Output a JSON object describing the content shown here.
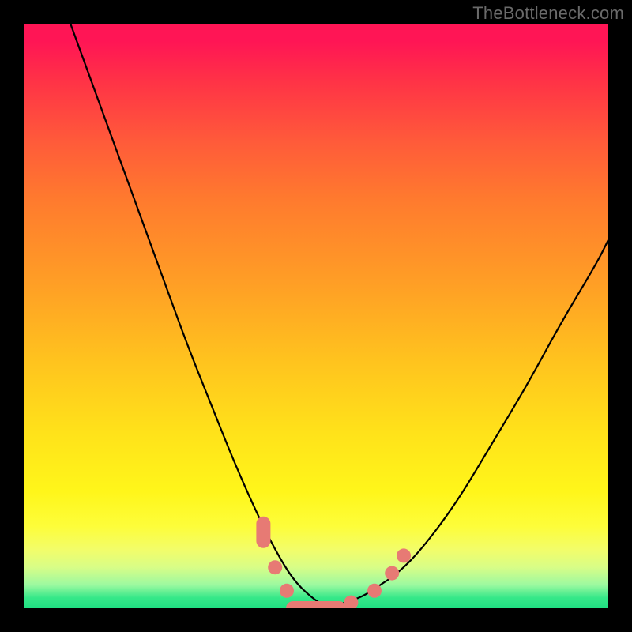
{
  "watermark": "TheBottleneck.com",
  "colors": {
    "background": "#000000",
    "curve": "#000000",
    "marker": "#e77a74",
    "gradient_top": "#ff1555",
    "gradient_bottom": "#1fdf82"
  },
  "chart_data": {
    "type": "line",
    "title": "",
    "xlabel": "",
    "ylabel": "",
    "xlim": [
      0,
      100
    ],
    "ylim": [
      0,
      100
    ],
    "grid": false,
    "legend": false,
    "note": "Bottleneck-style V-curve. x is an unlabeled normalized axis (0–100 left→right); y is bottleneck percentage where 0 = no bottleneck (bottom, green) and 100 = full bottleneck (top, red). Values estimated from pixel positions since axes are unlabeled.",
    "series": [
      {
        "name": "left-branch",
        "x": [
          8,
          12,
          16,
          20,
          24,
          28,
          32,
          36,
          40,
          43,
          46,
          49,
          52
        ],
        "y": [
          100,
          89,
          78,
          67,
          56,
          45,
          35,
          25,
          16,
          10,
          5,
          2,
          0
        ]
      },
      {
        "name": "right-branch",
        "x": [
          52,
          55,
          58,
          61,
          64,
          68,
          74,
          80,
          86,
          92,
          98,
          100
        ],
        "y": [
          0,
          1,
          2,
          4,
          6,
          10,
          18,
          28,
          38,
          49,
          59,
          63
        ]
      }
    ],
    "markers": {
      "description": "Salmon-colored rounded markers near the curve minimum along the bottom green band.",
      "points": [
        {
          "x": 41,
          "y": 13,
          "shape": "pill-vertical"
        },
        {
          "x": 43,
          "y": 7,
          "shape": "dot"
        },
        {
          "x": 45,
          "y": 3,
          "shape": "dot"
        },
        {
          "x": 50,
          "y": 0,
          "shape": "pill-horizontal"
        },
        {
          "x": 56,
          "y": 1,
          "shape": "dot"
        },
        {
          "x": 60,
          "y": 3,
          "shape": "dot"
        },
        {
          "x": 63,
          "y": 6,
          "shape": "dot"
        },
        {
          "x": 65,
          "y": 9,
          "shape": "dot"
        }
      ]
    }
  }
}
